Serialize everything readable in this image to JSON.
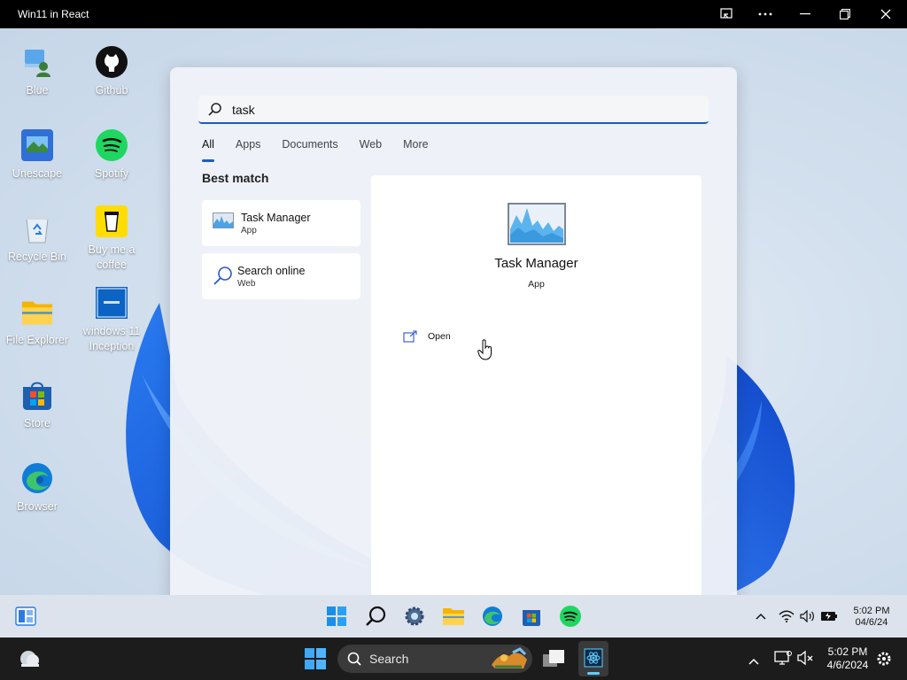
{
  "host_window": {
    "title": "Win11 in React"
  },
  "desktop_icons": [
    {
      "label": "Blue"
    },
    {
      "label": "Github"
    },
    {
      "label": "Unescape"
    },
    {
      "label": "Spotify"
    },
    {
      "label": "Recycle Bin"
    },
    {
      "label": "Buy me a coffee"
    },
    {
      "label": "File Explorer"
    },
    {
      "label": "windows 11 Inception"
    },
    {
      "label": "Store"
    },
    {
      "label": "Browser"
    }
  ],
  "search": {
    "query": "task",
    "tabs": [
      {
        "label": "All",
        "active": true
      },
      {
        "label": "Apps"
      },
      {
        "label": "Documents"
      },
      {
        "label": "Web"
      },
      {
        "label": "More"
      }
    ],
    "best_match_label": "Best match",
    "results": [
      {
        "title": "Task Manager",
        "subtitle": "App",
        "icon": "task-manager-icon"
      },
      {
        "title": "Search online",
        "subtitle": "Web",
        "icon": "search-icon"
      }
    ],
    "preview": {
      "title": "Task Manager",
      "subtitle": "App",
      "action_label": "Open"
    }
  },
  "taskbar": {
    "time": "5:02 PM",
    "date": "04/6/24",
    "apps": [
      "start-icon",
      "search-icon",
      "settings-icon",
      "file-explorer-icon",
      "edge-icon",
      "store-icon",
      "spotify-icon"
    ]
  },
  "host_taskbar": {
    "search_label": "Search",
    "time": "5:02 PM",
    "date": "4/6/2024"
  },
  "colors": {
    "accent": "#1a5fb4",
    "spotify": "#1ed760",
    "taskbar": "#e1e8f2",
    "host_taskbar": "#1c1c1c"
  }
}
